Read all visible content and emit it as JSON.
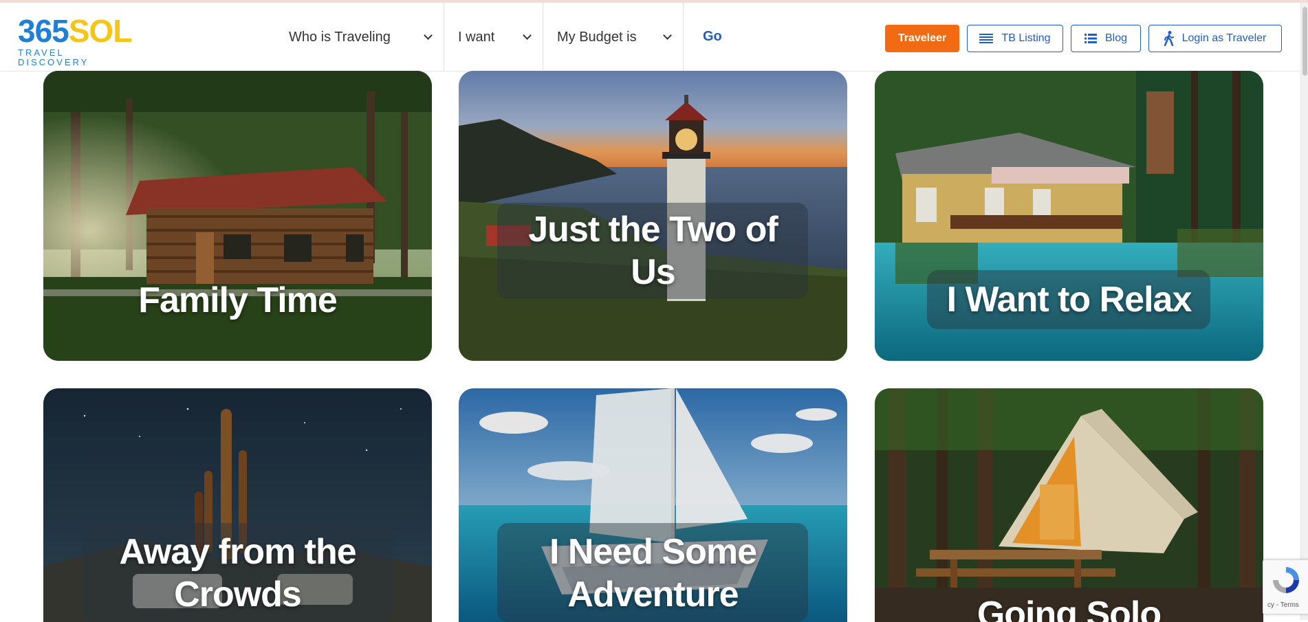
{
  "brand": {
    "logo_number": "365",
    "logo_word": "SOL",
    "logo_tagline": "TRAVEL DISCOVERY",
    "blue": "#1f7fd6",
    "yellow": "#f5c518"
  },
  "nav": {
    "selects": [
      {
        "label": "Who is Traveling",
        "icon": "chevron-down-icon"
      },
      {
        "label": "I want",
        "icon": "chevron-down-icon"
      },
      {
        "label": "My Budget is",
        "icon": "chevron-down-icon"
      }
    ],
    "go_label": "Go",
    "buttons": {
      "traveleer": "Traveleer",
      "tb_listing": "TB Listing",
      "blog": "Blog",
      "login": "Login as Traveler"
    },
    "accent_orange": "#f26a12",
    "accent_blue": "#1e5dc4"
  },
  "cards": [
    {
      "title": "Family Time",
      "scene": "log-cabin-in-forest"
    },
    {
      "title_line1": "Just the Two of",
      "title_line2": "Us",
      "scene": "lighthouse-at-sunset"
    },
    {
      "title": "I Want to Relax",
      "scene": "house-by-turquoise-lake"
    },
    {
      "title_line1": "Away from the",
      "title_line2": "Crowds",
      "scene": "desert-night-cactus"
    },
    {
      "title_line1": "I Need Some",
      "title_line2": "Adventure",
      "scene": "catamaran-sailing"
    },
    {
      "title": "Going Solo",
      "scene": "glamping-tent-forest"
    }
  ],
  "recaptcha": {
    "terms_text": "cy - Terms",
    "icon": "recaptcha-icon"
  }
}
